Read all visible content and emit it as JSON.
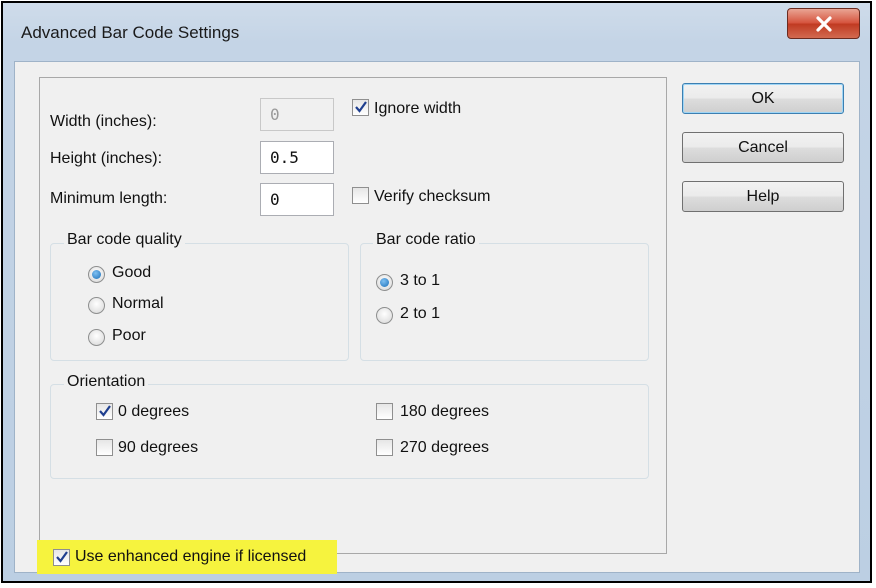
{
  "window": {
    "title": "Advanced Bar Code Settings",
    "close_icon": "close-x-icon"
  },
  "fields": {
    "width": {
      "label": "Width (inches):",
      "value": "0",
      "disabled": true
    },
    "height": {
      "label": "Height (inches):",
      "value": "0.5"
    },
    "min_length": {
      "label": "Minimum length:",
      "value": "0"
    }
  },
  "checkboxes": {
    "ignore_width": {
      "label": "Ignore width",
      "checked": true
    },
    "verify_checksum": {
      "label": "Verify checksum",
      "checked": false
    },
    "enhanced_engine": {
      "label": "Use enhanced engine if licensed",
      "checked": true
    }
  },
  "quality": {
    "legend": "Bar code quality",
    "options": [
      {
        "label": "Good",
        "selected": true
      },
      {
        "label": "Normal",
        "selected": false
      },
      {
        "label": "Poor",
        "selected": false
      }
    ]
  },
  "ratio": {
    "legend": "Bar code ratio",
    "options": [
      {
        "label": "3 to 1",
        "selected": true
      },
      {
        "label": "2 to 1",
        "selected": false
      }
    ]
  },
  "orientation": {
    "legend": "Orientation",
    "options": [
      {
        "label": "0 degrees",
        "checked": true
      },
      {
        "label": "90 degrees",
        "checked": false
      },
      {
        "label": "180 degrees",
        "checked": false
      },
      {
        "label": "270 degrees",
        "checked": false
      }
    ]
  },
  "buttons": {
    "ok": "OK",
    "cancel": "Cancel",
    "help": "Help"
  },
  "colors": {
    "highlight": "#f6f33e",
    "close_button": "#c74a33",
    "window_frame": "#c4d4e6"
  }
}
